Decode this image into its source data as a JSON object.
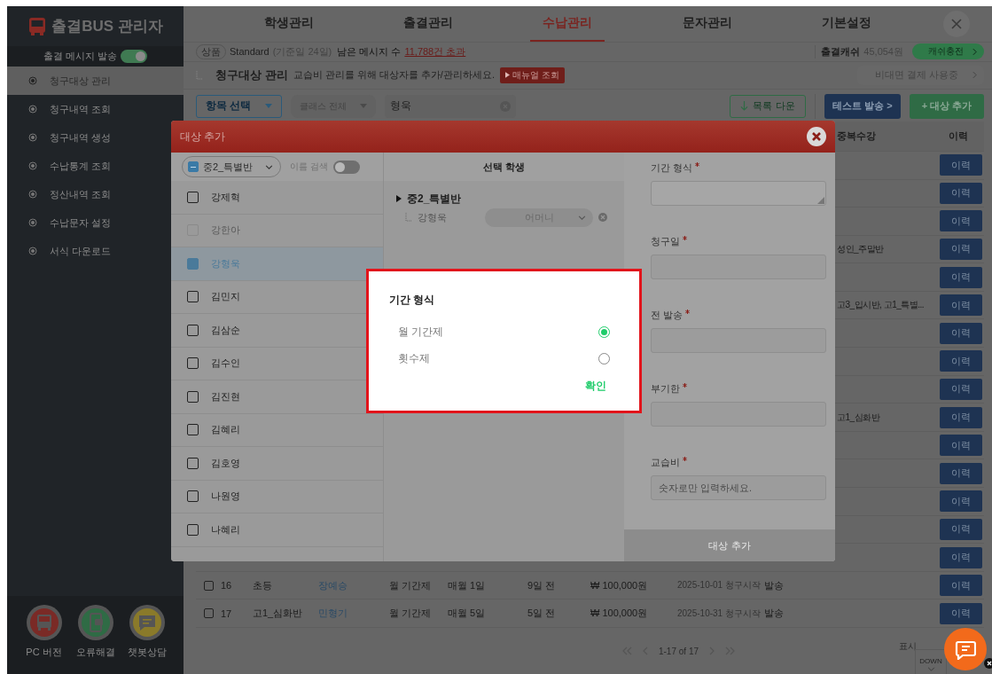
{
  "sidebar": {
    "logo": "출결BUS 관리자",
    "message_toggle": {
      "label": "출결 메시지 발송",
      "on": true
    },
    "items": [
      {
        "label": "청구대상 관리",
        "selected": true
      },
      {
        "label": "청구내역 조회",
        "selected": false
      },
      {
        "label": "청구내역 생성",
        "selected": false
      },
      {
        "label": "수납통계 조회",
        "selected": false
      },
      {
        "label": "정산내역 조회",
        "selected": false
      },
      {
        "label": "수납문자 설정",
        "selected": false
      },
      {
        "label": "서식 다운로드",
        "selected": false
      }
    ],
    "shortcuts": [
      {
        "kind": "pc",
        "label": "PC 버전"
      },
      {
        "kind": "phone",
        "label": "오류해결"
      },
      {
        "kind": "chat",
        "label": "챗봇상담"
      }
    ]
  },
  "nav": {
    "tabs": [
      {
        "label": "학생관리",
        "selected": false
      },
      {
        "label": "출결관리",
        "selected": false
      },
      {
        "label": "수납관리",
        "selected": true
      },
      {
        "label": "문자관리",
        "selected": false
      },
      {
        "label": "기본설정",
        "selected": false
      }
    ]
  },
  "info_bar": {
    "product_badge": "상품",
    "plan": "Standard",
    "plan_note": "(기준일 24일)",
    "messages_label": "남은 메시지 수",
    "messages_value": "11,788건 초과",
    "cash_label": "출결캐쉬",
    "cash_value": "45,054원",
    "cash_button": "캐쉬충전"
  },
  "page_header": {
    "title": "청구대상 관리",
    "subtitle": "교습비 관리를 위해 대상자를 추가/관리하세요.",
    "manual_button": "매뉴얼 조회",
    "payment_status": "비대면 결제 사용중"
  },
  "filters": {
    "category": "항목 선택",
    "class": "클래스 전체",
    "search": "형욱"
  },
  "actions": {
    "download": "목록 다운",
    "test_send": "테스트 발송 >",
    "add": "+ 대상 추가"
  },
  "table": {
    "columns": [
      "중복수강",
      "이력"
    ],
    "rows": [
      {
        "history": "이력"
      },
      {
        "history": "이력"
      },
      {
        "history": "이력"
      },
      {
        "duplicate": "성인_주말반",
        "history": "이력"
      },
      {
        "history": "이력"
      },
      {
        "duplicate": "고3_입시반, 고1_특별...",
        "history": "이력"
      },
      {
        "history": "이력"
      },
      {
        "history": "이력"
      },
      {
        "history": "이력"
      },
      {
        "duplicate": "고1_심화반",
        "history": "이력"
      },
      {
        "history": "이력"
      },
      {
        "history": "이력"
      },
      {
        "history": "이력"
      },
      {
        "history": "이력"
      },
      {
        "history": "이력"
      },
      {
        "checked": false,
        "number": "16",
        "class_name": "초등",
        "student": "장예승",
        "period_type": "월 기간제",
        "billing_day": "매월 1일",
        "notice": "9일 전",
        "amount": "₩ 100,000원",
        "status": "2025-10-01 청구시작",
        "send": "발송",
        "history": "이력"
      },
      {
        "checked": false,
        "number": "17",
        "class_name": "고1_심화반",
        "student": "민형기",
        "period_type": "월 기간제",
        "billing_day": "매월 5일",
        "notice": "5일 전",
        "amount": "₩ 100,000원",
        "status": "2025-10-31 청구시작",
        "send": "발송",
        "history": "이력"
      }
    ]
  },
  "pagination": {
    "range": "1-17 of 17",
    "page_size_label": "표시",
    "page_size_select": "DOWN"
  },
  "modal": {
    "title": "대상 추가",
    "class_select": {
      "value": "중2_특별반",
      "partial": true
    },
    "name_search": {
      "label": "이름 검색",
      "on": false
    },
    "students": [
      {
        "name": "강제혁",
        "checked": false,
        "disabled": false
      },
      {
        "name": "강한아",
        "checked": false,
        "disabled": true
      },
      {
        "name": "강형욱",
        "checked": true,
        "disabled": false
      },
      {
        "name": "김민지",
        "checked": false,
        "disabled": false
      },
      {
        "name": "김삼순",
        "checked": false,
        "disabled": false
      },
      {
        "name": "김수인",
        "checked": false,
        "disabled": false
      },
      {
        "name": "김진현",
        "checked": false,
        "disabled": false
      },
      {
        "name": "김혜리",
        "checked": false,
        "disabled": false
      },
      {
        "name": "김호영",
        "checked": false,
        "disabled": false
      },
      {
        "name": "나원영",
        "checked": false,
        "disabled": false
      },
      {
        "name": "나혜리",
        "checked": false,
        "disabled": false
      }
    ],
    "selected_panel": {
      "title": "선택 학생",
      "groups": [
        {
          "name": "중2_특별반",
          "children": [
            {
              "name": "강형욱",
              "guardian": "어머니"
            }
          ]
        }
      ]
    },
    "fields": [
      {
        "kind": "textarea",
        "label": "기간 형식",
        "required": true
      },
      {
        "kind": "input",
        "label": "청구일",
        "required": true
      },
      {
        "kind": "input",
        "label": "전 발송",
        "required": true
      },
      {
        "kind": "input",
        "label": "부기한",
        "required": true
      },
      {
        "kind": "input",
        "label": "교습비",
        "required": true,
        "placeholder": "숫자로만 입력하세요."
      }
    ],
    "submit_button": "대상 추가"
  },
  "popup": {
    "title": "기간 형식",
    "options": [
      {
        "label": "월 기간제",
        "selected": true
      },
      {
        "label": "횟수제",
        "selected": false
      }
    ],
    "confirm": "확인"
  }
}
